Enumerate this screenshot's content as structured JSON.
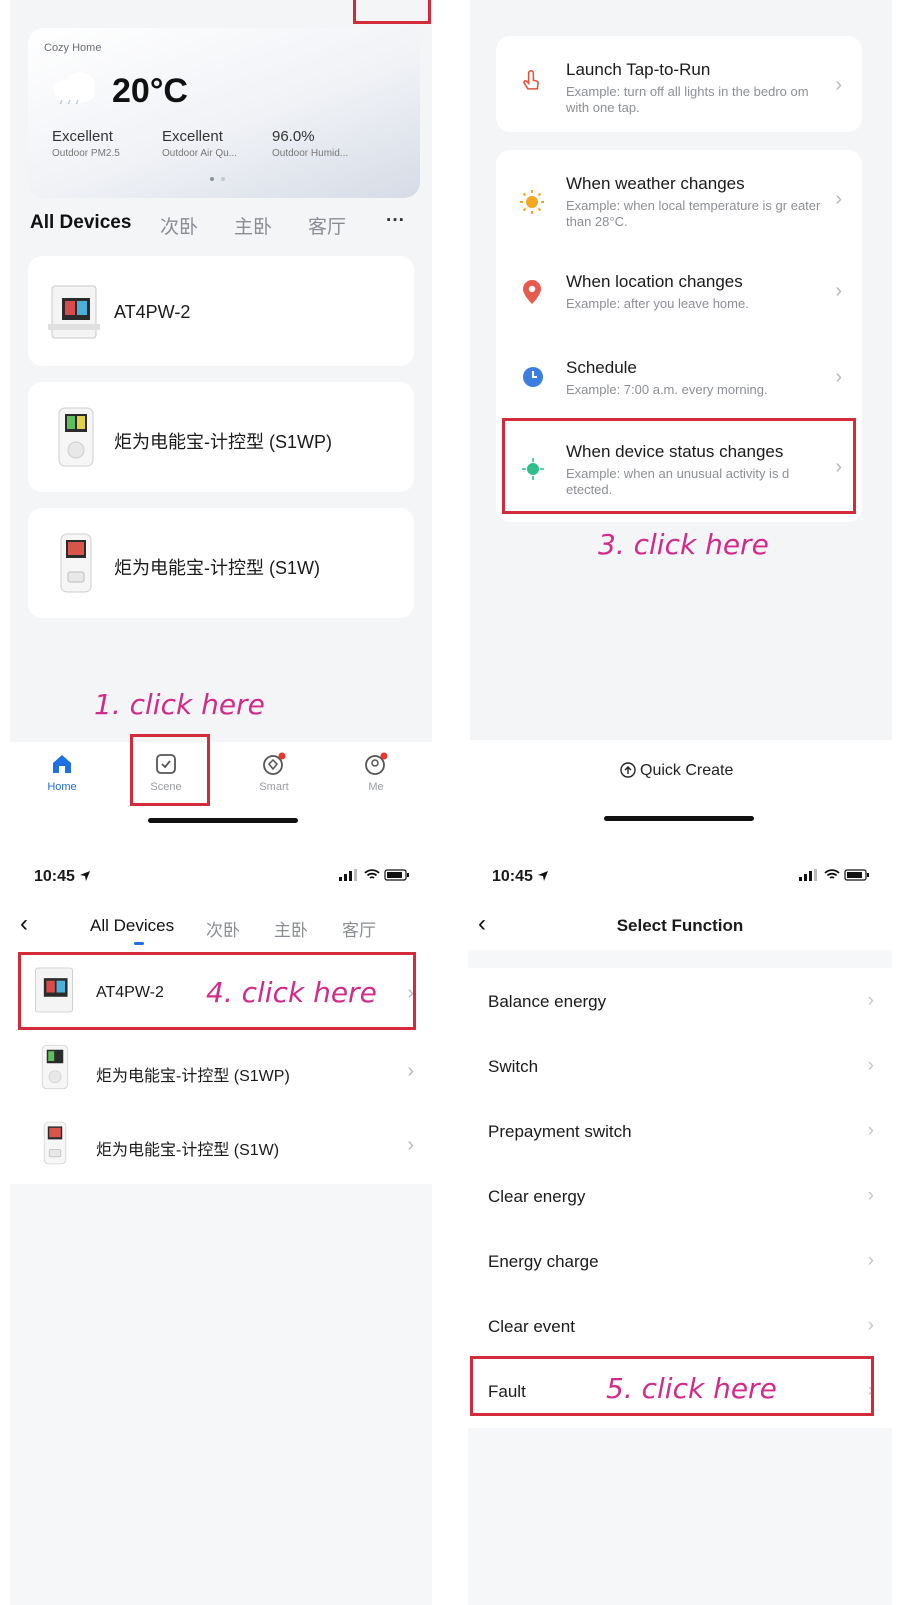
{
  "home": {
    "home_name": "Cozy Home",
    "temperature": "20°C",
    "stats": [
      {
        "value": "Excellent",
        "label": "Outdoor PM2.5"
      },
      {
        "value": "Excellent",
        "label": "Outdoor Air Qu..."
      },
      {
        "value": "96.0%",
        "label": "Outdoor Humid..."
      }
    ],
    "tabs": [
      "All Devices",
      "次卧",
      "主卧",
      "客厅"
    ],
    "more": "···",
    "devices": [
      "AT4PW-2",
      "炬为电能宝-计控型 (S1WP)",
      "炬为电能宝-计控型 (S1W)"
    ],
    "step_note": "1. click here",
    "nav": [
      {
        "label": "Home",
        "icon": "home-icon"
      },
      {
        "label": "Scene",
        "icon": "scene-icon"
      },
      {
        "label": "Smart",
        "icon": "smart-icon"
      },
      {
        "label": "Me",
        "icon": "me-icon"
      }
    ]
  },
  "scene": {
    "launch": {
      "title": "Launch Tap-to-Run",
      "desc": "Example: turn off all lights in the bedro om with one tap."
    },
    "conditions": [
      {
        "title": "When weather changes",
        "desc": "Example: when local temperature is gr eater than 28°C.",
        "icon": "sun-icon",
        "color": "#f5a623"
      },
      {
        "title": "When location changes",
        "desc": "Example: after you leave home.",
        "icon": "location-pin-icon",
        "color": "#e85a4f"
      },
      {
        "title": "Schedule",
        "desc": "Example: 7:00 a.m. every morning.",
        "icon": "clock-icon",
        "color": "#3d7fe0"
      },
      {
        "title": "When device status changes",
        "desc": "Example: when an unusual activity is d etected.",
        "icon": "device-status-icon",
        "color": "#2fbf8c"
      }
    ],
    "step_note": "3. click here",
    "quick_create": "Quick Create"
  },
  "device_select": {
    "time": "10:45",
    "tabs": [
      "All Devices",
      "次卧",
      "主卧",
      "客厅"
    ],
    "devices": [
      "AT4PW-2",
      "炬为电能宝-计控型 (S1WP)",
      "炬为电能宝-计控型 (S1W)"
    ],
    "step_note": "4. click here"
  },
  "function_select": {
    "time": "10:45",
    "title": "Select Function",
    "functions": [
      "Balance energy",
      "Switch",
      "Prepayment switch",
      "Clear energy",
      "Energy charge",
      "Clear event",
      "Fault"
    ],
    "step_note": "5. click here"
  },
  "colors": {
    "accent": "#1f6fe5",
    "annotation": "#d22c8a",
    "highlight_box": "#d32b3a"
  }
}
